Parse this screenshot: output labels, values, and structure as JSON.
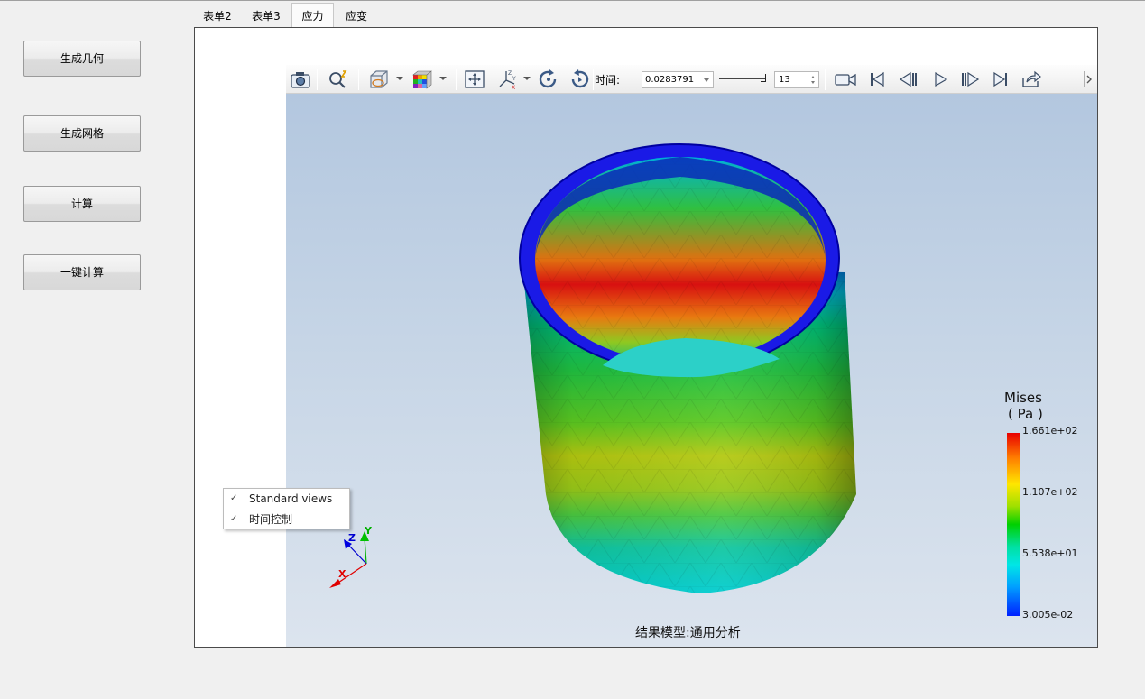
{
  "left_buttons": [
    "生成几何",
    "生成网格",
    "计算",
    "一键计算"
  ],
  "tabs": [
    {
      "label": "表单2"
    },
    {
      "label": "表单3"
    },
    {
      "label": "应力",
      "active": true
    },
    {
      "label": "应变"
    }
  ],
  "toolbar": {
    "icons": [
      "camera-icon",
      "zoom-magic-icon",
      "box-visibility-icon",
      "color-cube-icon",
      "fit-view-icon",
      "axes-orient-icon",
      "rotate-left-icon",
      "rotate-right-icon",
      "video-record-icon",
      "first-frame-icon",
      "prev-frame-icon",
      "play-icon",
      "next-frame-icon",
      "last-frame-icon",
      "export-icon"
    ],
    "time_label": "时间:",
    "time_value": "0.0283791",
    "frame_value": "13"
  },
  "context_menu": {
    "items": [
      {
        "label": "Standard views",
        "checked": true
      },
      {
        "label": "时间控制",
        "checked": true
      }
    ]
  },
  "axes": {
    "x": "X",
    "y": "Y",
    "z": "Z",
    "colors": {
      "x": "#e00000",
      "y": "#00c000",
      "z": "#0000e0"
    }
  },
  "legend": {
    "title": "Mises",
    "unit": "( Pa )",
    "values": [
      "1.661e+02",
      "1.107e+02",
      "5.538e+01",
      "3.005e-02"
    ],
    "colors": {
      "max": "#e80000",
      "mid": "#00d000",
      "min": "#0020ff"
    }
  },
  "viewport_caption": "结果模型:通用分析"
}
